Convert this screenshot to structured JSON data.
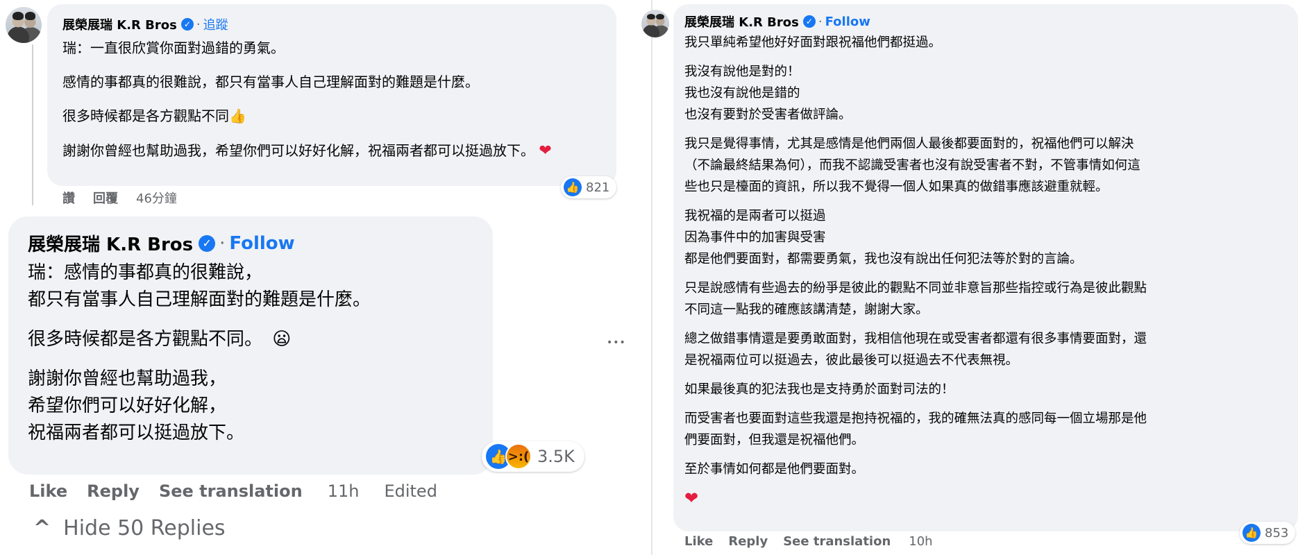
{
  "left_top": {
    "name": "展榮展瑞 K.R Bros",
    "follow_label": "追蹤",
    "separator": "·",
    "paragraphs": [
      "瑞：一直很欣賞你面對過錯的勇氣。",
      "感情的事都真的很難說，都只有當事人自己理解面對的難題是什麼。",
      "很多時候都是各方觀點不同👍",
      "謝謝你曾經也幫助過我，希望你們可以好好化解，祝福兩者都可以挺過放下。"
    ],
    "heart": "❤",
    "reaction_count": "821",
    "actions": {
      "like": "讚",
      "reply": "回覆",
      "time": "46分鐘"
    }
  },
  "left_main": {
    "name": "展榮展瑞 K.R Bros",
    "follow_label": "Follow",
    "separator": "·",
    "paragraphs": [
      [
        "瑞：感情的事都真的很難說，",
        "都只有當事人自己理解面對的難題是什麼。"
      ],
      [
        "很多時候都是各方觀點不同。"
      ],
      [
        "謝謝你曾經也幫助過我，",
        "希望你們可以好好化解，",
        "祝福兩者都可以挺過放下。"
      ]
    ],
    "sad_emoji": "😦",
    "reaction_count": "3.5K",
    "actions": {
      "like": "Like",
      "reply": "Reply",
      "translate": "See translation",
      "time": "11h",
      "edited": "Edited"
    },
    "more_icon": "•••",
    "hide_replies": "Hide 50 Replies",
    "chevron": "^"
  },
  "right": {
    "name": "展榮展瑞 K.R Bros",
    "follow_label": "Follow",
    "separator": "·",
    "paragraphs": [
      [
        "我只單純希望他好好面對跟祝福他們都挺過。"
      ],
      [
        "我沒有說他是對的！",
        "我也沒有說他是錯的",
        "也沒有要對於受害者做評論。"
      ],
      [
        "我只是覺得事情，尤其是感情是他們兩個人最後都要面對的，祝福他們可以解決",
        "（不論最終結果為何），而我不認識受害者也沒有說受害者不對，不管事情如何這",
        "些也只是檯面的資訊，所以我不覺得一個人如果真的做錯事應該避重就輕。"
      ],
      [
        "我祝福的是兩者可以挺過",
        "因為事件中的加害與受害",
        "都是他們要面對，都需要勇氣，我也沒有說出任何犯法等於對的言論。"
      ],
      [
        "只是說感情有些過去的紛爭是彼此的觀點不同並非意旨那些指控或行為是彼此觀點",
        "不同這一點我的確應該講清楚，謝謝大家。"
      ],
      [
        "總之做錯事情還是要勇敢面對，我相信他現在或受害者都還有很多事情要面對，還",
        "是祝福兩位可以挺過去，彼此最後可以挺過去不代表無視。"
      ],
      [
        "如果最後真的犯法我也是支持勇於面對司法的！"
      ],
      [
        "而受害者也要面對這些我還是抱持祝福的，我的確無法真的感同每一個立場那是他",
        "們要面對，但我還是祝福他們。"
      ],
      [
        "至於事情如何都是他們要面對。"
      ]
    ],
    "heart": "❤",
    "reaction_count": "853",
    "actions": {
      "like": "Like",
      "reply": "Reply",
      "translate": "See translation",
      "time": "10h"
    }
  },
  "colors": {
    "bubble": "#f0f2f5",
    "link": "#1877f2",
    "muted": "#65676b",
    "heart": "#e41e3f"
  }
}
